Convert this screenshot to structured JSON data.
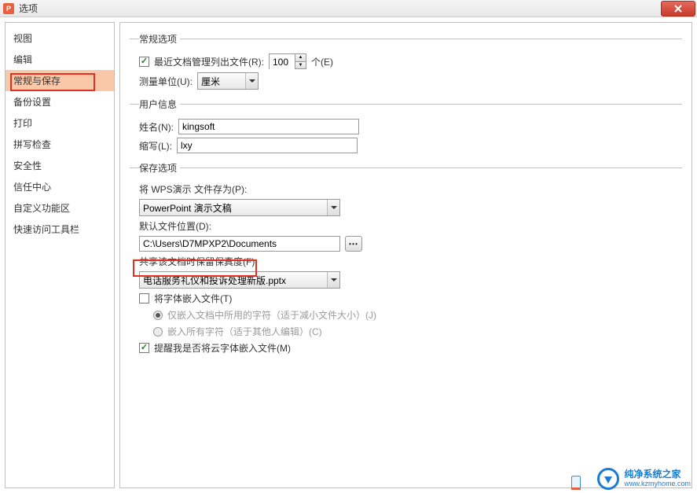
{
  "window": {
    "title": "选项"
  },
  "sidebar": {
    "items": [
      {
        "label": "视图"
      },
      {
        "label": "编辑"
      },
      {
        "label": "常规与保存"
      },
      {
        "label": "备份设置"
      },
      {
        "label": "打印"
      },
      {
        "label": "拼写检查"
      },
      {
        "label": "安全性"
      },
      {
        "label": "信任中心"
      },
      {
        "label": "自定义功能区"
      },
      {
        "label": "快速访问工具栏"
      }
    ]
  },
  "general": {
    "legend": "常规选项",
    "recent_label": "最近文档管理列出文件(R):",
    "recent_count": "100",
    "recent_unit": "个(E)",
    "measure_label": "测量单位(U):",
    "measure_value": "厘米"
  },
  "user": {
    "legend": "用户信息",
    "name_label": "姓名(N):",
    "name_value": "kingsoft",
    "initials_label": "缩写(L):",
    "initials_value": "lxy"
  },
  "save": {
    "legend": "保存选项",
    "saveas_label": "将 WPS演示 文件存为(P):",
    "saveas_value": "PowerPoint 演示文稿",
    "default_loc_label": "默认文件位置(D):",
    "default_loc_value": "C:\\Users\\D7MPXP2\\Documents",
    "fidelity_label": "共享该文档时保留保真度(F):",
    "fidelity_value": "电话服务礼仪和投诉处理新版.pptx",
    "embed_fonts": "将字体嵌入文件(T)",
    "embed_used": "仅嵌入文档中所用的字符（适于减小文件大小）(J)",
    "embed_all": "嵌入所有字符（适于其他人编辑）(C)",
    "remind_cloud": "提醒我是否将云字体嵌入文件(M)"
  },
  "watermark": {
    "brand": "纯净系统之家",
    "url": "www.kzmyhome.com"
  }
}
